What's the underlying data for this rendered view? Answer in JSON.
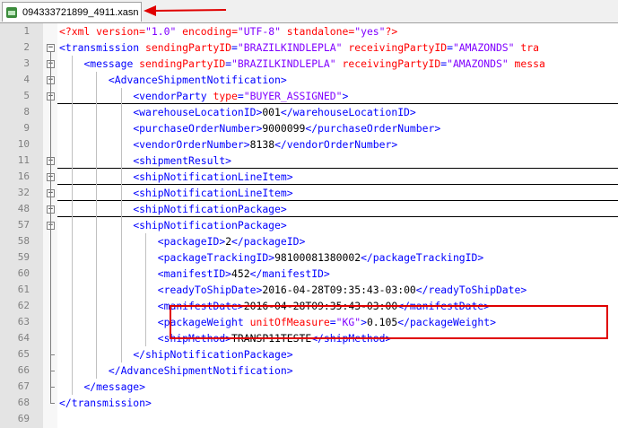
{
  "tab": {
    "filename": "094333721899_4911.xasn"
  },
  "colors": {
    "tag": "#0000ff",
    "attr": "#ff0000",
    "value": "#8000ff",
    "highlight": "#e00000"
  },
  "lines": [
    {
      "num": "1",
      "indent": 0,
      "fold": "none",
      "underline": false,
      "parts": [
        [
          "pi",
          "<?xml "
        ],
        [
          "at",
          "version"
        ],
        [
          "pi",
          "="
        ],
        [
          "st",
          "\"1.0\""
        ],
        [
          "at",
          " encoding"
        ],
        [
          "pi",
          "="
        ],
        [
          "st",
          "\"UTF-8\""
        ],
        [
          "at",
          " standalone"
        ],
        [
          "pi",
          "="
        ],
        [
          "st",
          "\"yes\""
        ],
        [
          "pi",
          "?>"
        ]
      ]
    },
    {
      "num": "2",
      "indent": 0,
      "fold": "open",
      "underline": false,
      "parts": [
        [
          "tg",
          "<transmission "
        ],
        [
          "at",
          "sendingPartyID"
        ],
        [
          "tg",
          "="
        ],
        [
          "st",
          "\"BRAZILKINDLEPLA\""
        ],
        [
          "at",
          " receivingPartyID"
        ],
        [
          "tg",
          "="
        ],
        [
          "st",
          "\"AMAZONDS\""
        ],
        [
          "at",
          " tra"
        ]
      ]
    },
    {
      "num": "3",
      "indent": 1,
      "fold": "open",
      "underline": false,
      "parts": [
        [
          "tg",
          "<message "
        ],
        [
          "at",
          "sendingPartyID"
        ],
        [
          "tg",
          "="
        ],
        [
          "st",
          "\"BRAZILKINDLEPLA\""
        ],
        [
          "at",
          " receivingPartyID"
        ],
        [
          "tg",
          "="
        ],
        [
          "st",
          "\"AMAZONDS\""
        ],
        [
          "at",
          " messa"
        ]
      ]
    },
    {
      "num": "4",
      "indent": 2,
      "fold": "open",
      "underline": false,
      "parts": [
        [
          "tg",
          "<AdvanceShipmentNotification>"
        ]
      ]
    },
    {
      "num": "5",
      "indent": 3,
      "fold": "closed",
      "underline": true,
      "parts": [
        [
          "tg",
          "<vendorParty "
        ],
        [
          "at",
          "type"
        ],
        [
          "tg",
          "="
        ],
        [
          "st",
          "\"BUYER_ASSIGNED\""
        ],
        [
          "tg",
          ">"
        ]
      ]
    },
    {
      "num": "8",
      "indent": 3,
      "fold": "none",
      "underline": false,
      "parts": [
        [
          "tg",
          "<warehouseLocationID>"
        ],
        [
          "tx",
          "001"
        ],
        [
          "tg",
          "</warehouseLocationID>"
        ]
      ]
    },
    {
      "num": "9",
      "indent": 3,
      "fold": "none",
      "underline": false,
      "parts": [
        [
          "tg",
          "<purchaseOrderNumber>"
        ],
        [
          "tx",
          "9000099"
        ],
        [
          "tg",
          "</purchaseOrderNumber>"
        ]
      ]
    },
    {
      "num": "10",
      "indent": 3,
      "fold": "none",
      "underline": false,
      "parts": [
        [
          "tg",
          "<vendorOrderNumber>"
        ],
        [
          "tx",
          "8138"
        ],
        [
          "tg",
          "</vendorOrderNumber>"
        ]
      ]
    },
    {
      "num": "11",
      "indent": 3,
      "fold": "closed",
      "underline": true,
      "parts": [
        [
          "tg",
          "<shipmentResult>"
        ]
      ]
    },
    {
      "num": "16",
      "indent": 3,
      "fold": "closed",
      "underline": true,
      "parts": [
        [
          "tg",
          "<shipNotificationLineItem>"
        ]
      ]
    },
    {
      "num": "32",
      "indent": 3,
      "fold": "closed",
      "underline": true,
      "parts": [
        [
          "tg",
          "<shipNotificationLineItem>"
        ]
      ]
    },
    {
      "num": "48",
      "indent": 3,
      "fold": "closed",
      "underline": true,
      "parts": [
        [
          "tg",
          "<shipNotificationPackage>"
        ]
      ]
    },
    {
      "num": "57",
      "indent": 3,
      "fold": "open",
      "underline": false,
      "parts": [
        [
          "tg",
          "<shipNotificationPackage>"
        ]
      ]
    },
    {
      "num": "58",
      "indent": 4,
      "fold": "none",
      "underline": false,
      "parts": [
        [
          "tg",
          "<packageID>"
        ],
        [
          "tx",
          "2"
        ],
        [
          "tg",
          "</packageID>"
        ]
      ]
    },
    {
      "num": "59",
      "indent": 4,
      "fold": "none",
      "underline": false,
      "parts": [
        [
          "tg",
          "<packageTrackingID>"
        ],
        [
          "tx",
          "98100081380002"
        ],
        [
          "tg",
          "</packageTrackingID>"
        ]
      ]
    },
    {
      "num": "60",
      "indent": 4,
      "fold": "none",
      "underline": false,
      "parts": [
        [
          "tg",
          "<manifestID>"
        ],
        [
          "tx",
          "452"
        ],
        [
          "tg",
          "</manifestID>"
        ]
      ]
    },
    {
      "num": "61",
      "indent": 4,
      "fold": "none",
      "underline": false,
      "parts": [
        [
          "tg",
          "<readyToShipDate>"
        ],
        [
          "tx",
          "2016-04-28T09:35:43-03:00"
        ],
        [
          "tg",
          "</readyToShipDate>"
        ]
      ]
    },
    {
      "num": "62",
      "indent": 4,
      "fold": "none",
      "underline": false,
      "parts": [
        [
          "tg",
          "<manifestDate>"
        ],
        [
          "tx",
          "2016-04-28T09:35:43-03:00"
        ],
        [
          "tg",
          "</manifestDate>"
        ]
      ]
    },
    {
      "num": "63",
      "indent": 4,
      "fold": "none",
      "underline": false,
      "parts": [
        [
          "tg",
          "<packageWeight "
        ],
        [
          "at",
          "unitOfMeasure"
        ],
        [
          "tg",
          "="
        ],
        [
          "st",
          "\"KG\""
        ],
        [
          "tg",
          ">"
        ],
        [
          "tx",
          "0.105"
        ],
        [
          "tg",
          "</packageWeight>"
        ]
      ]
    },
    {
      "num": "64",
      "indent": 4,
      "fold": "none",
      "underline": false,
      "parts": [
        [
          "tg",
          "<shipMethod>"
        ],
        [
          "tx",
          "TRANSP11TESTE"
        ],
        [
          "tg",
          "</shipMethod>"
        ]
      ]
    },
    {
      "num": "65",
      "indent": 3,
      "fold": "end",
      "underline": false,
      "parts": [
        [
          "tg",
          "</shipNotificationPackage>"
        ]
      ]
    },
    {
      "num": "66",
      "indent": 2,
      "fold": "end",
      "underline": false,
      "parts": [
        [
          "tg",
          "</AdvanceShipmentNotification>"
        ]
      ]
    },
    {
      "num": "67",
      "indent": 1,
      "fold": "end",
      "underline": false,
      "parts": [
        [
          "tg",
          "</message>"
        ]
      ]
    },
    {
      "num": "68",
      "indent": 0,
      "fold": "end",
      "underline": false,
      "parts": [
        [
          "tg",
          "</transmission>"
        ]
      ]
    },
    {
      "num": "69",
      "indent": 0,
      "fold": "none",
      "underline": false,
      "parts": []
    }
  ]
}
